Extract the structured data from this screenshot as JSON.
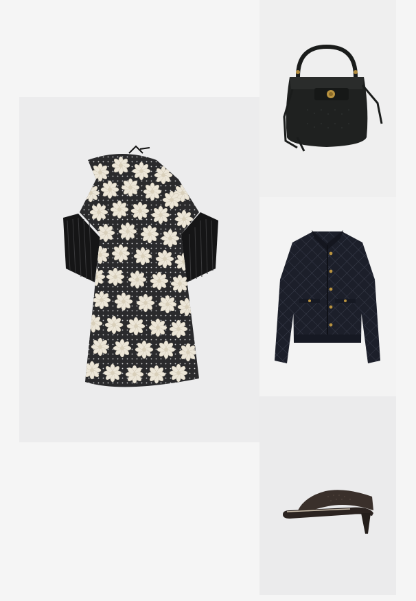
{
  "page": {
    "background": "#f5f5f5"
  },
  "products": [
    {
      "item": "dress",
      "icon": "floral-lace-dress-image",
      "tile_color": "#ececed"
    },
    {
      "item": "bag",
      "icon": "bucket-bag-image",
      "tile_color": "#efefef"
    },
    {
      "item": "jacket",
      "icon": "quilted-jacket-image",
      "tile_color": "#f3f3f3"
    },
    {
      "item": "shoe",
      "icon": "thong-sandal-image",
      "tile_color": "#ebebec"
    }
  ]
}
